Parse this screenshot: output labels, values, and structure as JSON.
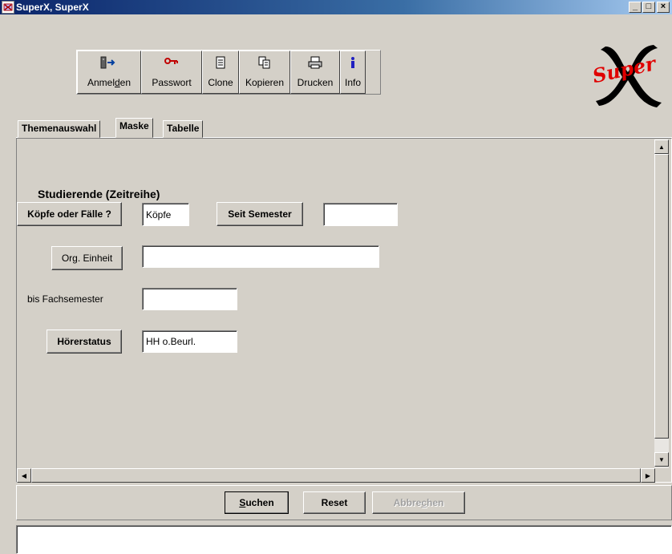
{
  "window": {
    "title": "SuperX, SuperX",
    "minimize_glyph": "_",
    "maximize_glyph": "□",
    "close_glyph": "×"
  },
  "toolbar": {
    "items": [
      {
        "label_pre": "Anmel",
        "label_u": "d",
        "label_post": "en",
        "icon": "login-icon"
      },
      {
        "label": "Passwort",
        "icon": "key-icon"
      },
      {
        "label": "Clone",
        "icon": "document-icon"
      },
      {
        "label": "Kopieren",
        "icon": "copy-icon"
      },
      {
        "label": "Drucken",
        "icon": "printer-icon"
      },
      {
        "label": "Info",
        "icon": "info-icon"
      }
    ]
  },
  "logo": {
    "text": "Super",
    "letter": "X"
  },
  "tabs": [
    {
      "label": "Themenauswahl",
      "active": false
    },
    {
      "label": "Maske",
      "active": true
    },
    {
      "label": "Tabelle",
      "active": false
    }
  ],
  "form": {
    "title": "Studierende (Zeitreihe)",
    "koepfe_button": "Köpfe oder Fälle ?",
    "koepfe_value": "Köpfe",
    "seit_semester_button": "Seit Semester",
    "seit_semester_value": "",
    "org_einheit_button": "Org. Einheit",
    "org_einheit_value": "",
    "bis_fachsemester_label": "bis Fachsemester",
    "bis_fachsemester_value": "",
    "hoererstatus_button": "Hörerstatus",
    "hoererstatus_value": "HH o.Beurl."
  },
  "actions": {
    "suchen": {
      "pre": "",
      "u": "S",
      "post": "uchen"
    },
    "reset": "Reset",
    "abbrechen": {
      "pre": "Abbre",
      "u": "c",
      "post": "hen"
    }
  },
  "status": {
    "text": ""
  },
  "colors": {
    "accent_red": "#e00000",
    "titlebar": "#0a246a"
  }
}
